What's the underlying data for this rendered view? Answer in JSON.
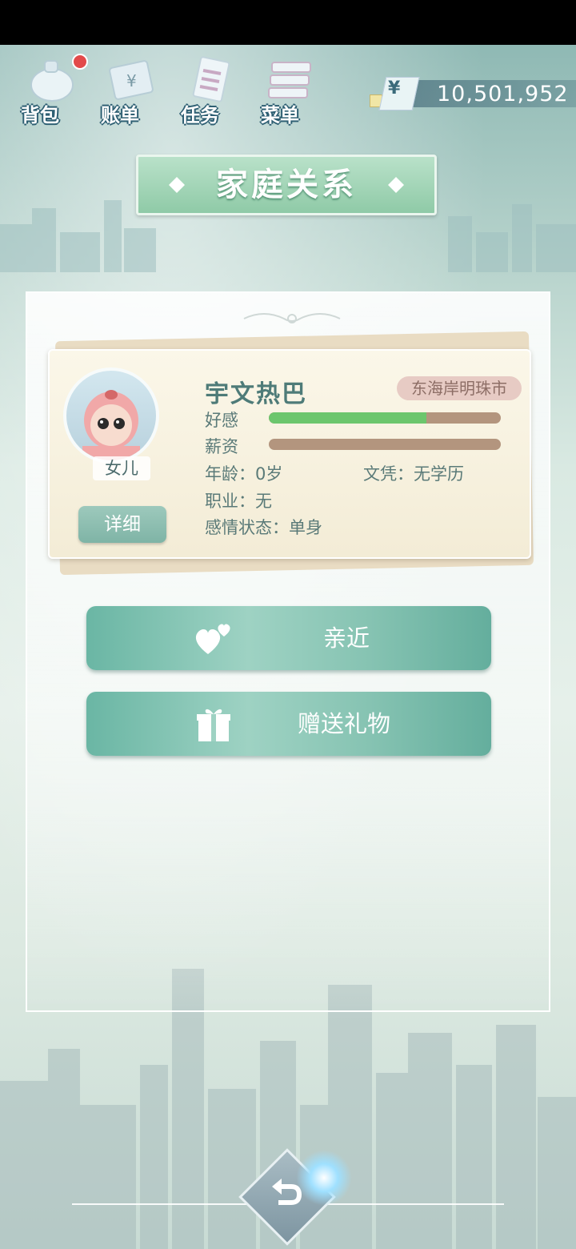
{
  "toolbar": {
    "items": [
      {
        "label": "背包",
        "icon": "backpack-icon"
      },
      {
        "label": "账单",
        "icon": "bill-icon"
      },
      {
        "label": "任务",
        "icon": "task-icon"
      },
      {
        "label": "菜单",
        "icon": "menu-icon"
      }
    ],
    "backpack_has_notification": true
  },
  "currency": {
    "symbol": "¥",
    "amount": "10,501,952"
  },
  "title": "家庭关系",
  "character": {
    "name": "宇文热巴",
    "location": "东海岸明珠市",
    "relation": "女儿",
    "detail_label": "详细",
    "affection_label": "好感",
    "affection_fraction": 0.68,
    "salary_label": "薪资",
    "salary_fraction": 0,
    "age": "年龄：0岁",
    "education": "文凭：无学历",
    "occupation": "职业：无",
    "relationship_status": "感情状态：单身"
  },
  "actions": [
    {
      "label": "亲近",
      "icon": "hearts-icon"
    },
    {
      "label": "赠送礼物",
      "icon": "gift-icon"
    }
  ],
  "colors": {
    "affection_bar": "#6cc66d",
    "bar_track": "#b3957e",
    "accent": "#7fb4a6"
  }
}
